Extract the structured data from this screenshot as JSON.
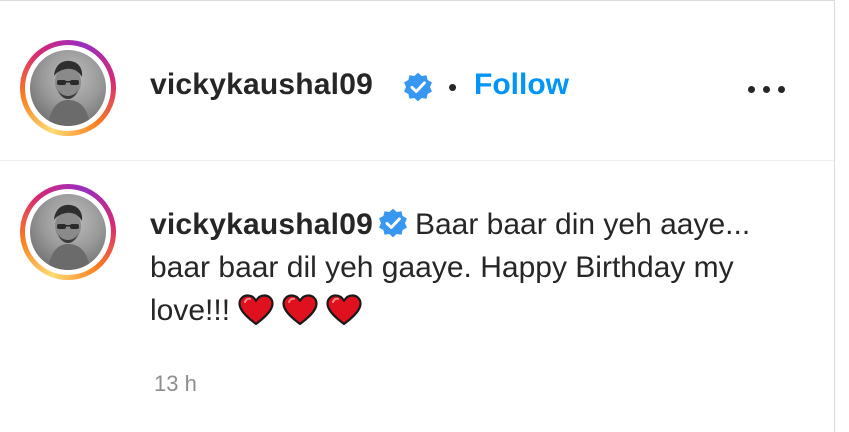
{
  "header": {
    "username": "vickykaushal09",
    "separator": "•",
    "follow_label": "Follow",
    "more_icon": "more-horizontal-icon"
  },
  "comment": {
    "username": "vickykaushal09",
    "text": "Baar baar din yeh aaye... baar baar dil yeh gaaye. Happy Birthday my love!!!",
    "emoji": [
      "red-heart",
      "red-heart",
      "red-heart"
    ],
    "timestamp": "13 h"
  },
  "colors": {
    "link_blue": "#0095f6",
    "verified_blue": "#3897f0",
    "text": "#262626",
    "muted": "#8e8e8e",
    "heart_red": "#e0111f"
  }
}
